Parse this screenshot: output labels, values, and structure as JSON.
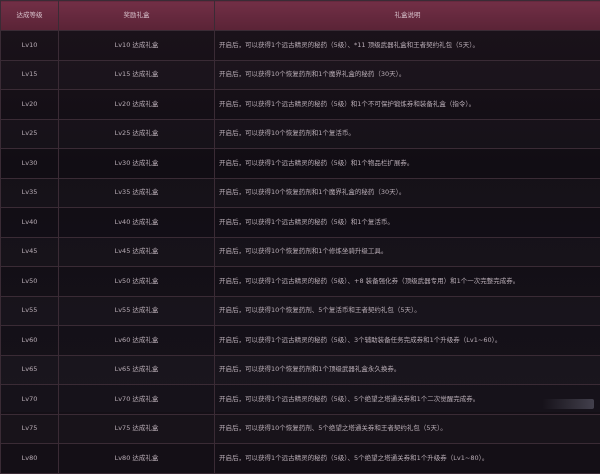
{
  "table": {
    "headers": [
      "达成等级",
      "奖励礼盒",
      "礼盒说明"
    ],
    "rows": [
      {
        "level": "Lv10",
        "gift": "Lv10 达成礼盒",
        "desc": "开启后，可以获得1个远古精灵的秘药（5级）、*11 顶级武器礼盒和王者契约礼包（5天）。"
      },
      {
        "level": "Lv15",
        "gift": "Lv15 达成礼盒",
        "desc": "开启后，可以获得10个恢复药剂和1个魔界礼盒的秘药（30天）。"
      },
      {
        "level": "Lv20",
        "gift": "Lv20 达成礼盒",
        "desc": "开启后，可以获得1个远古精灵的秘药（5级）和1个不可保护锻炼券和装备礼盒（指令）。"
      },
      {
        "level": "Lv25",
        "gift": "Lv25 达成礼盒",
        "desc": "开启后，可以获得10个恢复药剂和1个复活币。"
      },
      {
        "level": "Lv30",
        "gift": "Lv30 达成礼盒",
        "desc": "开启后，可以获得1个远古精灵的秘药（5级）和1个物品栏扩展券。"
      },
      {
        "level": "Lv35",
        "gift": "Lv35 达成礼盒",
        "desc": "开启后，可以获得10个恢复药剂和1个魔界礼盒的秘药（30天）。"
      },
      {
        "level": "Lv40",
        "gift": "Lv40 达成礼盒",
        "desc": "开启后，可以获得1个远古精灵的秘药（5级）和1个复活币。"
      },
      {
        "level": "Lv45",
        "gift": "Lv45 达成礼盒",
        "desc": "开启后，可以获得10个恢复药剂和1个修炼坐骑升级工具。"
      },
      {
        "level": "Lv50",
        "gift": "Lv50 达成礼盒",
        "desc": "开启后，可以获得1个远古精灵的秘药（5级）、+8 装备强化券（顶级武器专用）和1个一次完整完成券。"
      },
      {
        "level": "Lv55",
        "gift": "Lv55 达成礼盒",
        "desc": "开启后，可以获得10个恢复药剂、5个复活币和王者契约礼包（5天）。"
      },
      {
        "level": "Lv60",
        "gift": "Lv60 达成礼盒",
        "desc": "开启后，可以获得1个远古精灵的秘药（5级）、3个辅助装备任务完成券和1个升级券（Lv1~60）。"
      },
      {
        "level": "Lv65",
        "gift": "Lv65 达成礼盒",
        "desc": "开启后，可以获得10个恢复药剂和1个顶级武器礼盒永久换券。"
      },
      {
        "level": "Lv70",
        "gift": "Lv70 达成礼盒",
        "desc": "开启后，可以获得1个远古精灵的秘药（5级）、5个绝望之塔通关券和1个二次觉醒完成券。"
      },
      {
        "level": "Lv75",
        "gift": "Lv75 达成礼盒",
        "desc": "开启后，可以获得10个恢复药剂、5个绝望之塔通关券和王者契约礼包（5天）。"
      },
      {
        "level": "Lv80",
        "gift": "Lv80 达成礼盒",
        "desc": "开启后，可以获得1个远古精灵的秘药（5级）、5个绝望之塔通关券和1个升级券（Lv1~80）。"
      }
    ]
  }
}
